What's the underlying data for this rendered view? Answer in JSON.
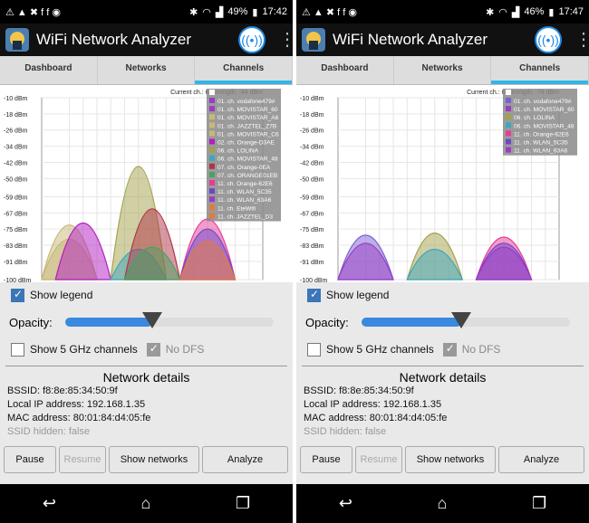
{
  "screens": [
    {
      "status": {
        "icons_left": "⚠ ▲ ✖ f f ◉",
        "battery": "49%",
        "time": "17:42"
      },
      "app_title": "WiFi Network Analyzer",
      "tabs": [
        "Dashboard",
        "Networks",
        "Channels"
      ],
      "chart_header": "Current ch.: 6, strength: -44 dBm",
      "y_labels": [
        "-10 dBm",
        "-18 dBm",
        "-26 dBm",
        "-34 dBm",
        "-42 dBm",
        "-50 dBm",
        "-59 dBm",
        "-67 dBm",
        "-75 dBm",
        "-83 dBm",
        "-91 dBm",
        "-100 dBm"
      ],
      "x_labels": [
        "1",
        "2",
        "3",
        "4",
        "5",
        "6",
        "7",
        "8",
        "9",
        "10",
        "11",
        "12",
        "13",
        "14"
      ],
      "legend": [
        {
          "label": "01. ch. vodafone479#",
          "color": "#9a3cc5"
        },
        {
          "label": "01. ch. MOVISTAR_60",
          "color": "#9a3cc5"
        },
        {
          "label": "01. ch. MOVISTAR_A6",
          "color": "#c8b878"
        },
        {
          "label": "01. ch. JAZZTEL_Z7B",
          "color": "#c8b878"
        },
        {
          "label": "01. ch. MOVISTAR_C6",
          "color": "#c8b878"
        },
        {
          "label": "02. ch. Orange-D3AE",
          "color": "#b21cc2"
        },
        {
          "label": "06. ch. LOLINA",
          "color": "#a3a14b"
        },
        {
          "label": "06. ch. MOVISTAR_48",
          "color": "#3ea6bd"
        },
        {
          "label": "07. ch. Orange-0EA",
          "color": "#b03347"
        },
        {
          "label": "07. ch. ORANGE01EB",
          "color": "#4aa262"
        },
        {
          "label": "11. ch. Orange-62E6",
          "color": "#e83a98"
        },
        {
          "label": "11. ch. WLAN_5C35",
          "color": "#6b48c7"
        },
        {
          "label": "11. ch. WLAN_63A6",
          "color": "#9a3cc5"
        },
        {
          "label": "11. ch. EteWifi",
          "color": "#e07b3c"
        },
        {
          "label": "11. ch. JAZZTEL_D3",
          "color": "#e07b3c"
        }
      ],
      "curves": [
        {
          "ch": 1,
          "dbm": -73,
          "color": "#c8b878"
        },
        {
          "ch": 1,
          "dbm": -80,
          "color": "#c8b878"
        },
        {
          "ch": 2,
          "dbm": -72,
          "color": "#b21cc2"
        },
        {
          "ch": 6,
          "dbm": -44,
          "color": "#a3a14b"
        },
        {
          "ch": 6,
          "dbm": -85,
          "color": "#3ea6bd"
        },
        {
          "ch": 7,
          "dbm": -65,
          "color": "#b03347"
        },
        {
          "ch": 7,
          "dbm": -84,
          "color": "#4aa262"
        },
        {
          "ch": 11,
          "dbm": -70,
          "color": "#e83a98"
        },
        {
          "ch": 11,
          "dbm": -75,
          "color": "#6b48c7"
        },
        {
          "ch": 11,
          "dbm": -81,
          "color": "#e07b3c"
        }
      ],
      "show_legend": "Show legend",
      "opacity_label": "Opacity:",
      "opacity": 0.42,
      "ghz_label": "Show 5 GHz channels",
      "nodfs_label": "No DFS",
      "details_title": "Network details",
      "bssid": "BSSID: f8:8e:85:34:50:9f",
      "ip": "Local IP address: 192.168.1.35",
      "mac": "MAC address: 80:01:84:d4:05:fe",
      "ssid_hidden": "SSID hidden: false",
      "btn_pause": "Pause",
      "btn_resume": "Resume",
      "btn_show": "Show networks",
      "btn_analyze": "Analyze"
    },
    {
      "status": {
        "icons_left": "⚠ ▲ ✖ f f ◉",
        "battery": "46%",
        "time": "17:47"
      },
      "app_title": "WiFi Network Analyzer",
      "tabs": [
        "Dashboard",
        "Networks",
        "Channels"
      ],
      "chart_header": "Current ch.: 6, strength: -78 dBm",
      "y_labels": [
        "-10 dBm",
        "-18 dBm",
        "-26 dBm",
        "-34 dBm",
        "-42 dBm",
        "-50 dBm",
        "-59 dBm",
        "-67 dBm",
        "-75 dBm",
        "-83 dBm",
        "-91 dBm",
        "-100 dBm"
      ],
      "x_labels": [
        "1",
        "2",
        "3",
        "4",
        "5",
        "6",
        "7",
        "8",
        "9",
        "10",
        "11",
        "12",
        "13",
        "14"
      ],
      "legend": [
        {
          "label": "01. ch. vodafone479#",
          "color": "#7b60d0"
        },
        {
          "label": "01. ch. MOVISTAR_60",
          "color": "#9a3cc5"
        },
        {
          "label": "06. ch. LOLINA",
          "color": "#a3a14b"
        },
        {
          "label": "06. ch. MOVISTAR_48",
          "color": "#3ea6bd"
        },
        {
          "label": "11. ch. Orange-62E6",
          "color": "#e83a98"
        },
        {
          "label": "11. ch. WLAN_5C35",
          "color": "#6b48c7"
        },
        {
          "label": "11. ch. WLAN_63A6",
          "color": "#9a3cc5"
        }
      ],
      "curves": [
        {
          "ch": 1,
          "dbm": -78,
          "color": "#7b60d0"
        },
        {
          "ch": 1,
          "dbm": -82,
          "color": "#9a3cc5"
        },
        {
          "ch": 6,
          "dbm": -77,
          "color": "#a3a14b"
        },
        {
          "ch": 6,
          "dbm": -85,
          "color": "#3ea6bd"
        },
        {
          "ch": 11,
          "dbm": -79,
          "color": "#e83a98"
        },
        {
          "ch": 11,
          "dbm": -82,
          "color": "#6b48c7"
        },
        {
          "ch": 11,
          "dbm": -84,
          "color": "#9a3cc5"
        }
      ],
      "show_legend": "Show legend",
      "opacity_label": "Opacity:",
      "opacity": 0.48,
      "ghz_label": "Show 5 GHz channels",
      "nodfs_label": "No DFS",
      "details_title": "Network details",
      "bssid": "BSSID: f8:8e:85:34:50:9f",
      "ip": "Local IP address: 192.168.1.35",
      "mac": "MAC address: 80:01:84:d4:05:fe",
      "ssid_hidden": "SSID hidden: false",
      "btn_pause": "Pause",
      "btn_resume": "Resume",
      "btn_show": "Show networks",
      "btn_analyze": "Analyze"
    }
  ]
}
